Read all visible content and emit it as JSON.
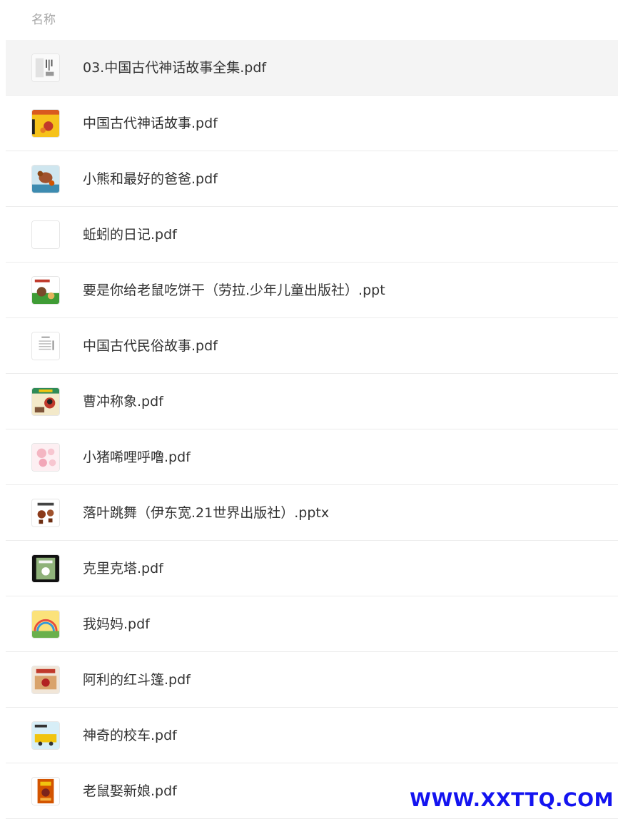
{
  "list": {
    "header": "名称",
    "files": [
      {
        "name": "03.中国古代神话故事全集.pdf",
        "thumb": "book-cover-icon"
      },
      {
        "name": "中国古代神话故事.pdf",
        "thumb": "book-cover-icon"
      },
      {
        "name": "小熊和最好的爸爸.pdf",
        "thumb": "book-cover-icon"
      },
      {
        "name": "蚯蚓的日记.pdf",
        "thumb": "blank-thumbnail"
      },
      {
        "name": "要是你给老鼠吃饼干（劳拉.少年儿童出版社）.ppt",
        "thumb": "book-cover-icon"
      },
      {
        "name": "中国古代民俗故事.pdf",
        "thumb": "document-page-icon"
      },
      {
        "name": "曹冲称象.pdf",
        "thumb": "book-cover-icon"
      },
      {
        "name": "小猪唏哩呼噜.pdf",
        "thumb": "book-cover-icon"
      },
      {
        "name": "落叶跳舞（伊东宽.21世界出版社）.pptx",
        "thumb": "book-cover-icon"
      },
      {
        "name": "克里克塔.pdf",
        "thumb": "book-cover-icon"
      },
      {
        "name": "我妈妈.pdf",
        "thumb": "book-cover-icon"
      },
      {
        "name": "阿利的红斗篷.pdf",
        "thumb": "book-cover-icon"
      },
      {
        "name": "神奇的校车.pdf",
        "thumb": "book-cover-icon"
      },
      {
        "name": "老鼠娶新娘.pdf",
        "thumb": "book-cover-icon"
      }
    ]
  },
  "watermark": "WWW.XXTTQ.COM",
  "colors": {
    "header_text": "#a8a8a8",
    "file_text": "#333333",
    "selected_row": "#f4f4f4",
    "divider": "#ececec",
    "watermark": "#1414f0"
  }
}
